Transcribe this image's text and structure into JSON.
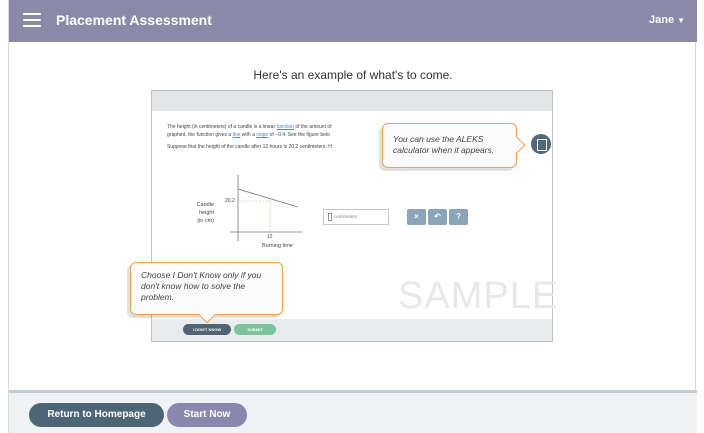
{
  "header": {
    "title": "Placement Assessment",
    "user_name": "Jane",
    "user_caret": "▼",
    "menu_icon": "hamburger-menu-icon"
  },
  "intro": {
    "text": "Here's an example of what's to come."
  },
  "sample": {
    "problem_line1_a": "The height (in centimeters) of a candle is a linear ",
    "problem_link1": "function",
    "problem_line1_b": " of the amount of",
    "problem_line2_a": "graphed, the function gives a ",
    "problem_link2": "line",
    "problem_line2_b": " with a ",
    "problem_link3": "slope",
    "problem_line2_c": " of −0.4. See the figure belo",
    "problem_line3": "Suppose that the height of the candle after 12 hours is 20.2 centimeters. H",
    "graph": {
      "y_axis_label": [
        "Candle",
        "height",
        "(in cm)"
      ],
      "y_tick": "20.2",
      "x_tick": "12",
      "x_axis_label": "Burning time"
    },
    "answer_unit": "centimeters",
    "tools": [
      "×",
      "↶",
      "?"
    ],
    "watermark": "SAMPLE",
    "calculator_icon": "calculator-icon",
    "btn_dont_know": "I DON'T KNOW",
    "btn_submit": "SUBMIT"
  },
  "callouts": {
    "calculator": "You can use the ALEKS calculator when it appears.",
    "dont_know": "Choose I Don't Know only if you don't know how to solve the problem."
  },
  "footer": {
    "return_label": "Return to Homepage",
    "start_label": "Start Now"
  },
  "colors": {
    "header": "#8a8aa8",
    "return_button": "#4d6676",
    "start_button": "#8b86ad",
    "callout_border": "#f0a24a"
  }
}
